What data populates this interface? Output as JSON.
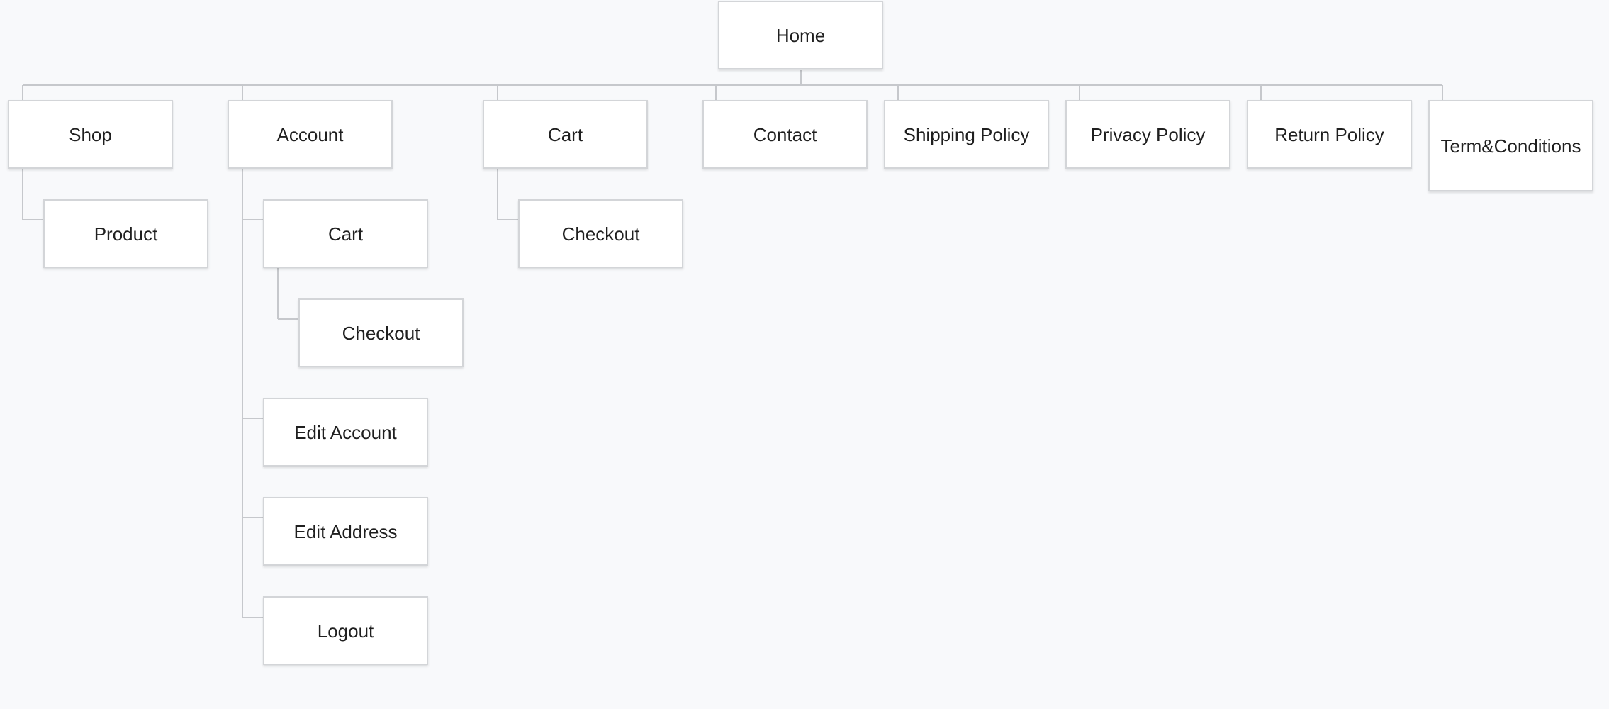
{
  "sitemap": {
    "home": "Home",
    "shop": "Shop",
    "product": "Product",
    "account": "Account",
    "account_cart": "Cart",
    "account_checkout": "Checkout",
    "edit_account": "Edit Account",
    "edit_address": "Edit Address",
    "logout": "Logout",
    "cart": "Cart",
    "cart_checkout": "Checkout",
    "contact": "Contact",
    "shipping_policy": "Shipping Policy",
    "privacy_policy": "Privacy Policy",
    "return_policy": "Return Policy",
    "terms": "Term&Conditions"
  },
  "colors": {
    "background": "#f8f9fb",
    "node_fill": "#ffffff",
    "node_border": "#d3d5d8",
    "connector": "#c6c8cc",
    "text": "#1f1f1f"
  }
}
